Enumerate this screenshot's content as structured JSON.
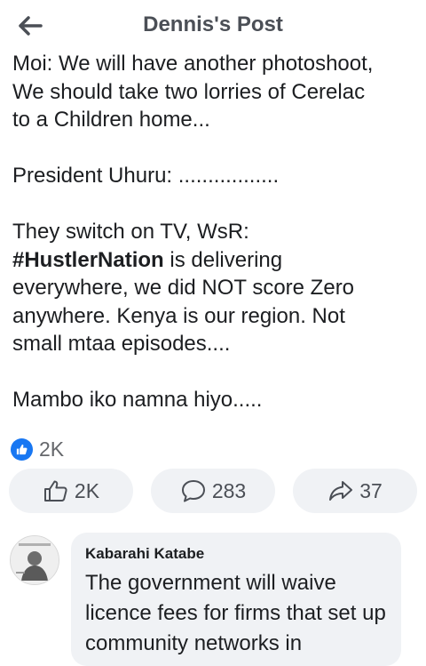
{
  "header": {
    "title": "Dennis's Post",
    "back_icon": "arrow-left-icon"
  },
  "post": {
    "lines": [
      "Moi:  We will have another photoshoot,",
      "We should take two lorries of  Cerelac",
      "to a Children home...",
      "",
      "President Uhuru: .................",
      "",
      "They switch on TV, WsR:",
      {
        "hashtag": "#HustlerNation",
        "rest": " is delivering"
      },
      "everywhere, we did NOT score Zero",
      "anywhere. Kenya is our region. Not",
      "small mtaa episodes....",
      "",
      "Mambo iko namna hiyo....."
    ]
  },
  "reactions": {
    "icon": "like-icon",
    "count": "2K"
  },
  "actions": {
    "like": {
      "icon": "thumbs-up-icon",
      "count": "2K"
    },
    "comment": {
      "icon": "comment-icon",
      "count": "283"
    },
    "share": {
      "icon": "share-icon",
      "count": "37"
    }
  },
  "comment": {
    "author": "Kabarahi Katabe",
    "text": "The government will waive licence fees for firms that set up community networks in"
  },
  "colors": {
    "accent": "#1877f2",
    "pill_bg": "#f0f2f5",
    "text": "#1c1e21",
    "muted": "#65676b"
  }
}
